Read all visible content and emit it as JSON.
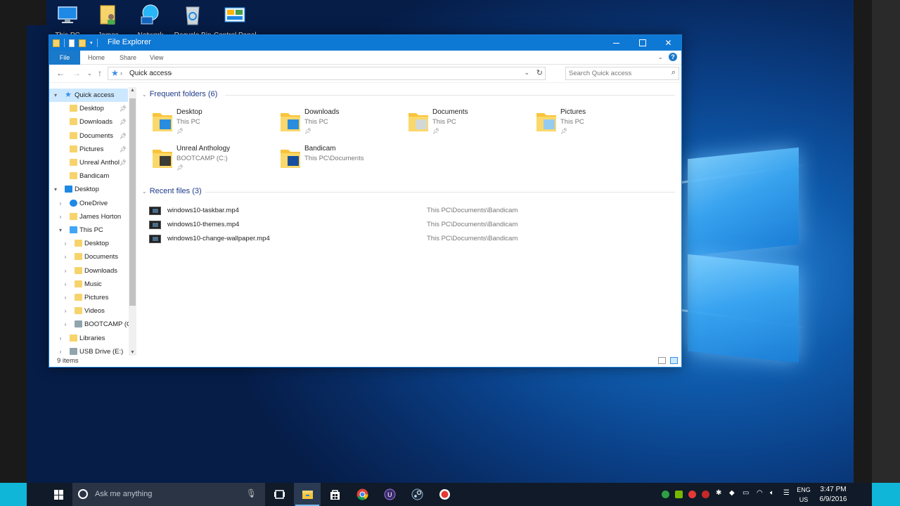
{
  "desktop": {
    "icons": [
      {
        "label": "This PC",
        "icon": "computer-icon"
      },
      {
        "label": "James",
        "icon": "user-folder-icon"
      },
      {
        "label": "Network",
        "icon": "network-icon"
      },
      {
        "label": "Recycle Bin",
        "icon": "recycle-bin-icon"
      },
      {
        "label": "Control Panel",
        "icon": "control-panel-icon"
      }
    ]
  },
  "window": {
    "title": "File Explorer",
    "ribbon_tabs": [
      "File",
      "Home",
      "Share",
      "View"
    ],
    "address": {
      "crumb": "Quick access",
      "separator": ">"
    },
    "search_placeholder": "Search Quick access",
    "status_count": "9 items"
  },
  "nav_pane": {
    "items": [
      {
        "label": "Quick access",
        "icon": "star-icon",
        "expanded": true,
        "selected": true
      },
      {
        "label": "Desktop",
        "icon": "folder-icon",
        "pinned": true
      },
      {
        "label": "Downloads",
        "icon": "folder-icon",
        "pinned": true
      },
      {
        "label": "Documents",
        "icon": "folder-icon",
        "pinned": true
      },
      {
        "label": "Pictures",
        "icon": "folder-icon",
        "pinned": true
      },
      {
        "label": "Unreal Anthol",
        "icon": "folder-icon",
        "pinned": true
      },
      {
        "label": "Bandicam",
        "icon": "folder-icon"
      },
      {
        "label": "Desktop",
        "icon": "desktop-icon",
        "expanded": true
      },
      {
        "label": "OneDrive",
        "icon": "cloud-icon"
      },
      {
        "label": "James Horton",
        "icon": "user-icon"
      },
      {
        "label": "This PC",
        "icon": "computer-icon",
        "expanded": true
      },
      {
        "label": "Desktop",
        "icon": "folder-icon"
      },
      {
        "label": "Documents",
        "icon": "folder-icon"
      },
      {
        "label": "Downloads",
        "icon": "folder-icon"
      },
      {
        "label": "Music",
        "icon": "music-folder-icon"
      },
      {
        "label": "Pictures",
        "icon": "folder-icon"
      },
      {
        "label": "Videos",
        "icon": "video-folder-icon"
      },
      {
        "label": "BOOTCAMP (C:",
        "icon": "drive-icon"
      },
      {
        "label": "Libraries",
        "icon": "folder-icon"
      },
      {
        "label": "USB Drive (E:)",
        "icon": "usb-drive-icon"
      }
    ]
  },
  "content": {
    "frequent_header": "Frequent folders (6)",
    "recent_header": "Recent files (3)",
    "frequent": [
      {
        "name": "Desktop",
        "location": "This PC",
        "pinned": true,
        "accent": "#1e88e5"
      },
      {
        "name": "Downloads",
        "location": "This PC",
        "pinned": true,
        "accent": "#1e88e5"
      },
      {
        "name": "Documents",
        "location": "This PC",
        "pinned": true,
        "accent": "#cfd8dc"
      },
      {
        "name": "Pictures",
        "location": "This PC",
        "pinned": true,
        "accent": "#90caf9"
      },
      {
        "name": "Unreal Anthology",
        "location": "BOOTCAMP (C:)",
        "pinned": true,
        "accent": "#333333"
      },
      {
        "name": "Bandicam",
        "location": "This PC\\Documents",
        "pinned": false,
        "accent": "#0d47a1"
      }
    ],
    "recent": [
      {
        "name": "windows10-taskbar.mp4",
        "path": "This PC\\Documents\\Bandicam"
      },
      {
        "name": "windows10-themes.mp4",
        "path": "This PC\\Documents\\Bandicam"
      },
      {
        "name": "windows10-change-wallpaper.mp4",
        "path": "This PC\\Documents\\Bandicam"
      }
    ]
  },
  "taskbar": {
    "search_placeholder": "Ask me anything",
    "apps": [
      "task-view-icon",
      "file-explorer-icon",
      "store-icon",
      "chrome-icon",
      "unreal-icon",
      "steam-icon",
      "bandicam-record-icon"
    ],
    "lang_top": "ENG",
    "lang_bottom": "US",
    "time": "3:47 PM",
    "date": "6/9/2016"
  },
  "colors": {
    "accent": "#0e78d5",
    "selection": "#cce8ff",
    "folder": "#f6d46b"
  }
}
